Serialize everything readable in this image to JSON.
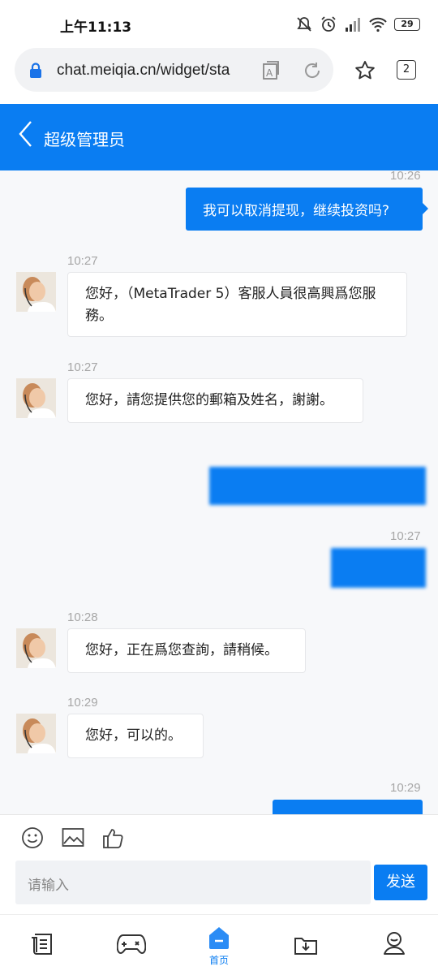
{
  "status_bar": {
    "time": "上午11:13",
    "battery": "29"
  },
  "browser": {
    "url": "chat.meiqia.cn/widget/sta",
    "tab_count": "2"
  },
  "header": {
    "back_label": "<",
    "title": "超级管理员"
  },
  "messages": [
    {
      "side": "right",
      "time": "10:26",
      "text": "我可以取消提现，继续投资吗?"
    },
    {
      "side": "left",
      "time": "10:27",
      "text": "您好，（MetaTrader 5）客服人員很高興爲您服務。"
    },
    {
      "side": "left",
      "time": "10:27",
      "text": "您好，請您提供您的郵箱及姓名，謝謝。"
    },
    {
      "side": "right",
      "time": "",
      "text": ""
    },
    {
      "side": "right",
      "time": "10:27",
      "text": ""
    },
    {
      "side": "left",
      "time": "10:28",
      "text": "您好，正在爲您查詢，請稍候。"
    },
    {
      "side": "left",
      "time": "10:29",
      "text": "您好，可以的。"
    },
    {
      "side": "right",
      "time": "10:29",
      "text": ""
    }
  ],
  "composer": {
    "placeholder": "请输入",
    "send_label": "发送"
  },
  "bottom_nav": {
    "home_label": "首页"
  },
  "colors": {
    "accent": "#0a7df2",
    "chat_bg": "#f7f8fa",
    "input_bg": "#f0f2f5"
  }
}
